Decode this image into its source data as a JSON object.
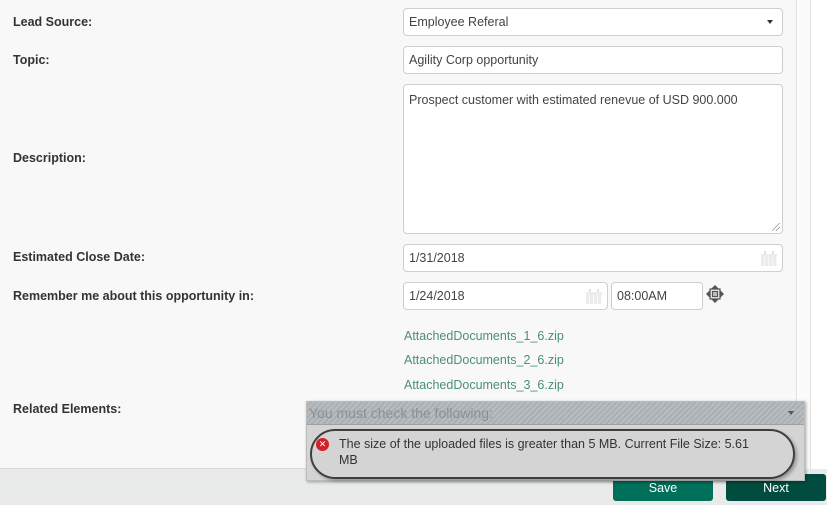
{
  "form": {
    "lead_source": {
      "label": "Lead Source:",
      "value": "Employee Referal"
    },
    "topic": {
      "label": "Topic:",
      "value": "Agility Corp opportunity"
    },
    "description": {
      "label": "Description:",
      "value": "Prospect customer with estimated renevue of USD 900.000"
    },
    "estimated_close_date": {
      "label": "Estimated Close Date:",
      "value": "1/31/2018"
    },
    "reminder": {
      "label": "Remember me about this opportunity in:",
      "date": "1/24/2018",
      "time": "08:00AM"
    },
    "attachments": [
      "AttachedDocuments_1_6.zip",
      "AttachedDocuments_2_6.zip",
      "AttachedDocuments_3_6.zip"
    ],
    "related_elements": {
      "label": "Related Elements:"
    }
  },
  "validation": {
    "title": "You must check the following:",
    "message": "The size of the uploaded files is greater than 5 MB. Current File Size: 5.61 MB",
    "icon": "error-circle-icon",
    "color": "#d3202d"
  },
  "footer": {
    "save_label": "Save",
    "next_label": "Next",
    "save_color": "#00705b",
    "next_color": "#004d40"
  }
}
